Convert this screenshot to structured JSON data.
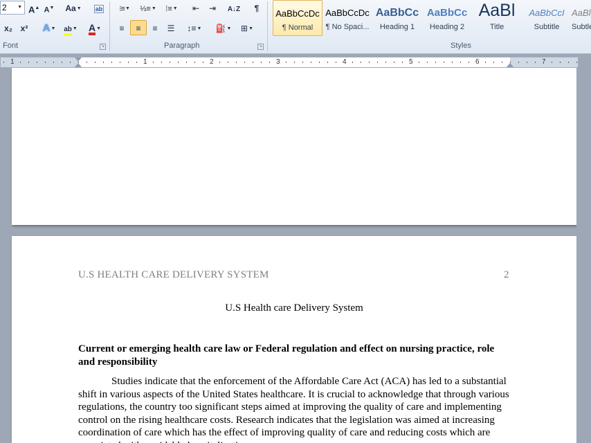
{
  "ribbon": {
    "font_size_value": "2",
    "font_group_label": "Font",
    "paragraph_group_label": "Paragraph",
    "styles_group_label": "Styles",
    "grow_font_label": "A",
    "shrink_font_label": "A",
    "change_case_label": "Aa",
    "subscript_label": "x₂",
    "superscript_label": "x²",
    "show_marks_label": "¶",
    "styles": [
      {
        "sample": "AaBbCcDc",
        "name": "¶ Normal"
      },
      {
        "sample": "AaBbCcDc",
        "name": "¶ No Spaci..."
      },
      {
        "sample": "AaBbCc",
        "name": "Heading 1"
      },
      {
        "sample": "AaBbCc",
        "name": "Heading 2"
      },
      {
        "sample": "AaBl",
        "name": "Title"
      },
      {
        "sample": "AaBbCcI",
        "name": "Subtitle"
      },
      {
        "sample": "AaBl",
        "name": "Subtle"
      }
    ]
  },
  "ruler": {
    "numbers": [
      "1",
      "1",
      "2",
      "3",
      "4",
      "5",
      "6",
      "7"
    ]
  },
  "document": {
    "header_title": "U.S HEALTH CARE DELIVERY SYSTEM",
    "page_number": "2",
    "title": "U.S Health care Delivery System",
    "heading": "Current or emerging health care law or Federal regulation and effect on nursing practice, role and responsibility",
    "body": "Studies indicate that the enforcement of the Affordable Care Act (ACA) has led to a substantial shift in various aspects of the United States healthcare. It is crucial to acknowledge that through various regulations, the country too significant steps aimed at improving the quality of care and implementing control on the rising healthcare costs. Research indicates that the legislation was aimed at increasing coordination of care which has the effect of improving quality of care and reducing costs which are associated with avoidable hospitalizations."
  }
}
